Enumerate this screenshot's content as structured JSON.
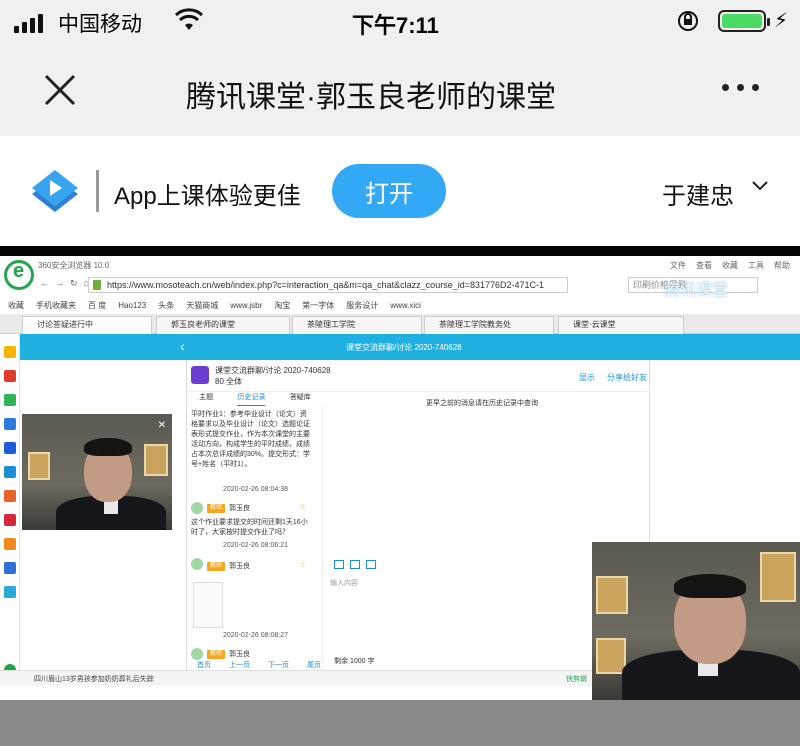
{
  "status_bar": {
    "carrier": "中国移动",
    "time": "下午7:11"
  },
  "nav": {
    "title": "腾讯课堂·郭玉良老师的课堂"
  },
  "banner": {
    "text": "App上课体验更佳",
    "open_label": "打开",
    "user": "于建忠"
  },
  "browser": {
    "app_title": "360安全浏览器 10.0",
    "menu": [
      "文件",
      "查看",
      "收藏",
      "工具",
      "帮助"
    ],
    "url": "https://www.mosoteach.cn/web/index.php?c=interaction_qa&m=qa_chat&clazz_course_id=831776D2-471C-1",
    "search_placeholder": "印刷价格暴跌",
    "bookmarks": [
      "收藏",
      "手机收藏夹",
      "百 度",
      "Hao123",
      "头条",
      "天猫商城",
      "www.jsbr",
      "淘宝",
      "第一字体",
      "服务设计",
      "www.xici"
    ],
    "tabs": [
      "讨论答疑进行中",
      "郭玉良老师的课堂",
      "茶陵理工学院",
      "茶陵理工学院教务处",
      "课堂·云课堂"
    ],
    "watermark": "腾讯课堂",
    "status_left": "四川眉山13岁男孩参加奶奶葬礼后失踪",
    "status_right": "快剪辑"
  },
  "page": {
    "header_title": "课堂交流群聊/讨论 2020-740628",
    "room_name": "课堂交流群聊/讨论 2020-740628",
    "room_count": "80 全体",
    "link_a": "显示",
    "link_b": "分享给好友",
    "tabs": [
      "主题",
      "历史记录",
      "答疑库"
    ],
    "active_tab": "历史记录",
    "right_hint": "更早之前的消息请在历史记录中查询",
    "input_placeholder": "输入内容",
    "input_counter": "剩余 1000 字",
    "pager": [
      "首页",
      "上一页",
      "下一页",
      "尾页"
    ]
  },
  "messages": [
    {
      "text": "平时作业1：参考毕业设计（论文）资格要求以及毕业设计（论文）选题论证表形式提交作业，作为本次课堂的主要活动方向，构成学生的平时成绩，成绩占本次总评成绩的30%。提交形式：学号+姓名（平时1）。",
      "time": "2020-02-26 08:04:38"
    },
    {
      "tag": "教师",
      "name": "郭玉良",
      "text": "这个作业要求提交的时间还剩1天16小时了，大家按时提交作业了吗？",
      "time": "2020-02-26 08:06:21"
    },
    {
      "tag": "教师",
      "name": "郭玉良",
      "time": "2020-02-26 08:08:27"
    },
    {
      "tag": "教师",
      "name": "郭玉良"
    }
  ],
  "colors": {
    "accent": "#33a9f5",
    "header": "#1fb0e0",
    "battery": "#4cd964"
  }
}
